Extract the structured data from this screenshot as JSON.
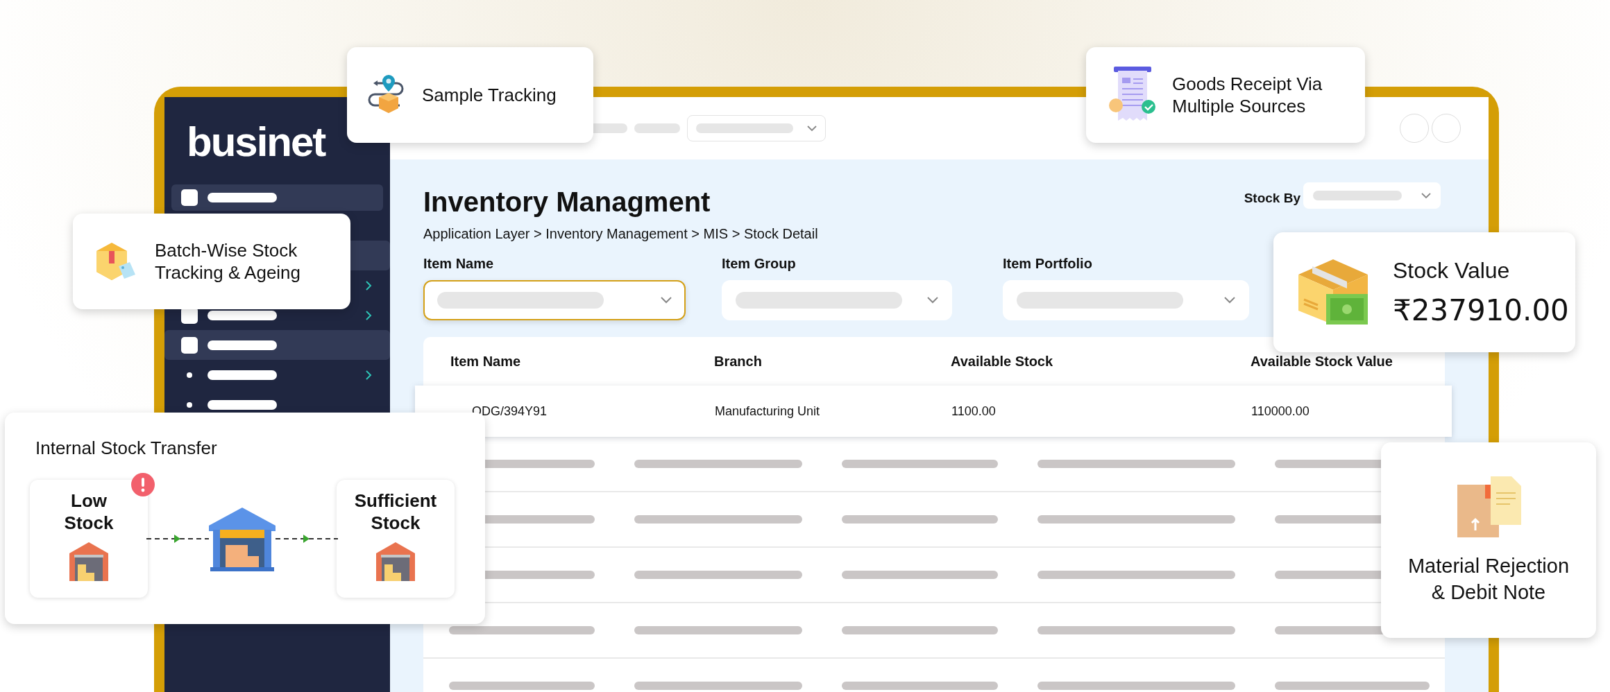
{
  "logo": "businet",
  "sidebar": {
    "items": [
      {
        "kind": "square",
        "selected": true,
        "expandable": false
      },
      {
        "kind": "blank",
        "selected": false,
        "expandable": false
      },
      {
        "kind": "blank",
        "selected": true,
        "expandable": false
      },
      {
        "kind": "blank",
        "selected": false,
        "expandable": true
      },
      {
        "kind": "square",
        "selected": false,
        "expandable": true
      },
      {
        "kind": "square",
        "selected": true,
        "expandable": false
      },
      {
        "kind": "dot",
        "selected": false,
        "expandable": true
      },
      {
        "kind": "dot",
        "selected": false,
        "expandable": false
      }
    ]
  },
  "page": {
    "title": "Inventory Managment",
    "breadcrumb": "Application Layer > Inventory Management > MIS > Stock Detail",
    "stock_by": {
      "label": "Stock By"
    }
  },
  "filters": [
    {
      "label": "Item Name",
      "focused": true
    },
    {
      "label": "Item Group",
      "focused": false
    },
    {
      "label": "Item Portfolio",
      "focused": false
    }
  ],
  "table": {
    "columns": [
      "Item Name",
      "Branch",
      "Available Stock",
      "Available Stock Value"
    ],
    "rows": [
      [
        "ODG/394Y91",
        "Manufacturing Unit",
        "1100.00",
        "110000.00"
      ]
    ]
  },
  "cards": {
    "sample_tracking": {
      "lines": [
        "Sample Tracking"
      ]
    },
    "goods_receipt": {
      "lines": [
        "Goods Receipt Via",
        "Multiple Sources"
      ]
    },
    "batch_stock": {
      "lines": [
        "Batch-Wise Stock",
        "Tracking & Ageing"
      ]
    },
    "stock_value": {
      "label": "Stock Value",
      "value": "₹237910.00"
    },
    "stock_transfer": {
      "title": "Internal Stock Transfer",
      "from": {
        "lines": [
          "Low",
          "Stock"
        ],
        "alert": true
      },
      "to": {
        "lines": [
          "Sufficient",
          "Stock"
        ],
        "alert": false
      }
    },
    "material_rejection": {
      "lines": [
        "Material Rejection",
        "& Debit Note"
      ]
    }
  }
}
